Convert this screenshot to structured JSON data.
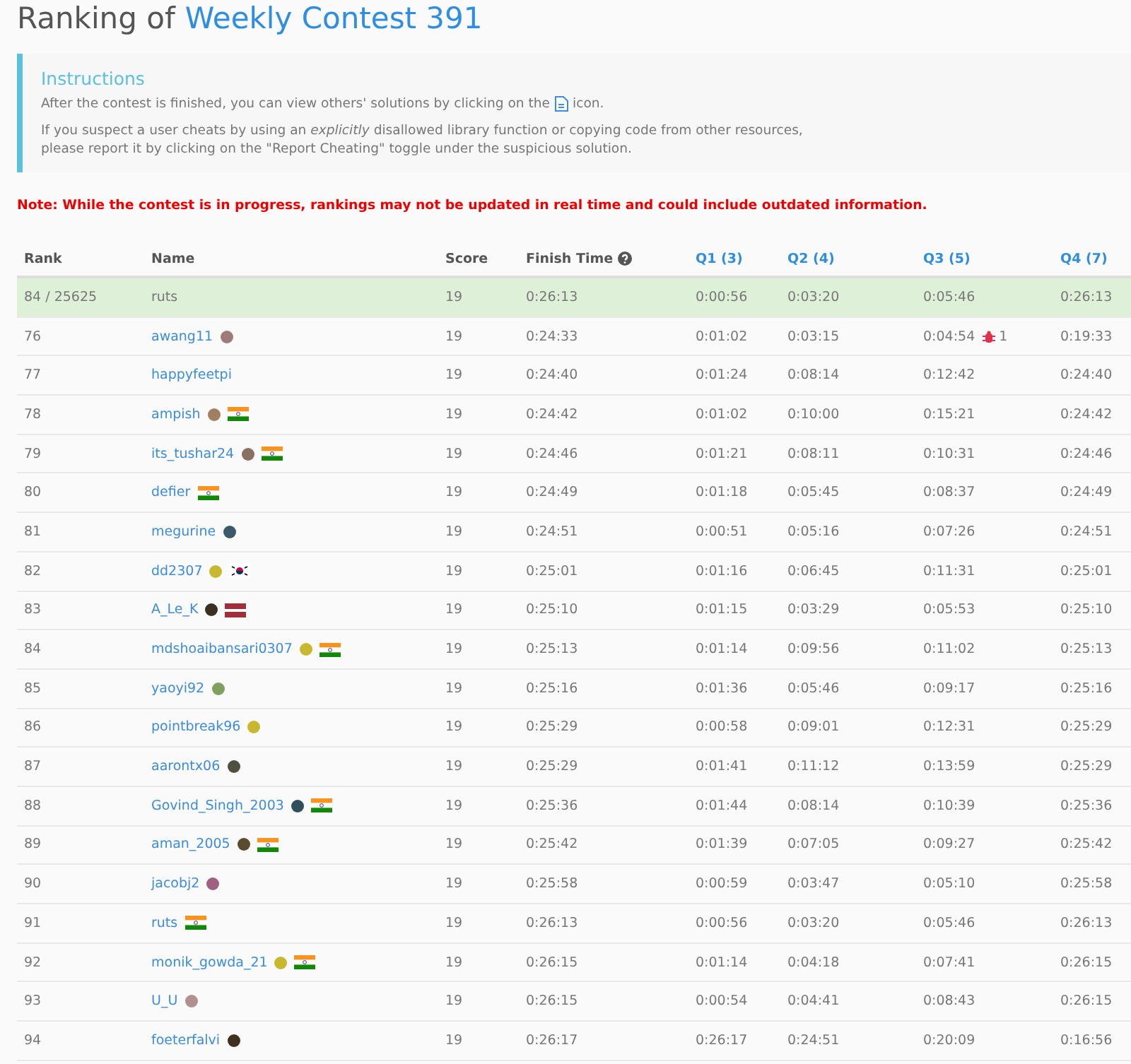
{
  "title": {
    "prefix": "Ranking of",
    "contest": "Weekly Contest 391"
  },
  "instructions": {
    "heading": "Instructions",
    "line1_before": "After the contest is finished, you can view others' solutions by clicking on the",
    "line1_after": "icon.",
    "paragraph2": "If you suspect a user cheats by using an *explicitly* disallowed library function or copying code from other resources, please report it by clicking on the \"Report Cheating\" toggle under the suspicious solution."
  },
  "note": "Note: While the contest is in progress, rankings may not be updated in real time and could include outdated information.",
  "table": {
    "columns": [
      "Rank",
      "Name",
      "Score",
      "Finish Time",
      "Q1 (3)",
      "Q2 (4)",
      "Q3 (5)",
      "Q4 (7)"
    ],
    "rows": [
      {
        "rank": "84 / 25625",
        "name": "ruts",
        "current": true,
        "score": "19",
        "finish": "0:26:13",
        "q": [
          "0:00:56",
          "0:03:20",
          "0:05:46",
          "0:26:13"
        ]
      },
      {
        "rank": "76",
        "name": "awang11",
        "current": false,
        "avatar": {
          "color": "#a07a7a"
        },
        "score": "19",
        "finish": "0:24:33",
        "q": [
          "0:01:02",
          "0:03:15",
          {
            "time": "0:04:54",
            "wrong": "1"
          },
          "0:19:33"
        ]
      },
      {
        "rank": "77",
        "name": "happyfeetpi",
        "current": false,
        "score": "19",
        "finish": "0:24:40",
        "q": [
          "0:01:24",
          "0:08:14",
          "0:12:42",
          "0:24:40"
        ]
      },
      {
        "rank": "78",
        "name": "ampish",
        "current": false,
        "avatar": {
          "color": "#a08060"
        },
        "flag": {
          "kind": "in"
        },
        "score": "19",
        "finish": "0:24:42",
        "q": [
          "0:01:02",
          "0:10:00",
          "0:15:21",
          "0:24:42"
        ]
      },
      {
        "rank": "79",
        "name": "its_tushar24",
        "current": false,
        "avatar": {
          "color": "#8a7060"
        },
        "flag": {
          "kind": "in"
        },
        "score": "19",
        "finish": "0:24:46",
        "q": [
          "0:01:21",
          "0:08:11",
          "0:10:31",
          "0:24:46"
        ]
      },
      {
        "rank": "80",
        "name": "defier",
        "current": false,
        "flag": {
          "kind": "in"
        },
        "score": "19",
        "finish": "0:24:49",
        "q": [
          "0:01:18",
          "0:05:45",
          "0:08:37",
          "0:24:49"
        ]
      },
      {
        "rank": "81",
        "name": "megurine",
        "current": false,
        "avatar": {
          "color": "#3a5a6a"
        },
        "score": "19",
        "finish": "0:24:51",
        "q": [
          "0:00:51",
          "0:05:16",
          "0:07:26",
          "0:24:51"
        ]
      },
      {
        "rank": "82",
        "name": "dd2307",
        "current": false,
        "avatar": {
          "color": "#c8b830"
        },
        "flag": {
          "kind": "kr"
        },
        "score": "19",
        "finish": "0:25:01",
        "q": [
          "0:01:16",
          "0:06:45",
          "0:11:31",
          "0:25:01"
        ]
      },
      {
        "rank": "83",
        "name": "A_Le_K",
        "current": false,
        "avatar": {
          "color": "#3a3020"
        },
        "flag": {
          "kind": "lv"
        },
        "score": "19",
        "finish": "0:25:10",
        "q": [
          "0:01:15",
          "0:03:29",
          "0:05:53",
          "0:25:10"
        ]
      },
      {
        "rank": "84",
        "name": "mdshoaibansari0307",
        "current": false,
        "avatar": {
          "color": "#c8b830"
        },
        "flag": {
          "kind": "in"
        },
        "score": "19",
        "finish": "0:25:13",
        "q": [
          "0:01:14",
          "0:09:56",
          "0:11:02",
          "0:25:13"
        ]
      },
      {
        "rank": "85",
        "name": "yaoyi92",
        "current": false,
        "avatar": {
          "color": "#80a060"
        },
        "score": "19",
        "finish": "0:25:16",
        "q": [
          "0:01:36",
          "0:05:46",
          "0:09:17",
          "0:25:16"
        ]
      },
      {
        "rank": "86",
        "name": "pointbreak96",
        "current": false,
        "avatar": {
          "color": "#c8b830"
        },
        "score": "19",
        "finish": "0:25:29",
        "q": [
          "0:00:58",
          "0:09:01",
          "0:12:31",
          "0:25:29"
        ]
      },
      {
        "rank": "87",
        "name": "aarontx06",
        "current": false,
        "avatar": {
          "color": "#505040"
        },
        "score": "19",
        "finish": "0:25:29",
        "q": [
          "0:01:41",
          "0:11:12",
          "0:13:59",
          "0:25:29"
        ]
      },
      {
        "rank": "88",
        "name": "Govind_Singh_2003",
        "current": false,
        "avatar": {
          "color": "#2f4f5a"
        },
        "flag": {
          "kind": "in"
        },
        "score": "19",
        "finish": "0:25:36",
        "q": [
          "0:01:44",
          "0:08:14",
          "0:10:39",
          "0:25:36"
        ]
      },
      {
        "rank": "89",
        "name": "aman_2005",
        "current": false,
        "avatar": {
          "color": "#5a4a30"
        },
        "flag": {
          "kind": "in"
        },
        "score": "19",
        "finish": "0:25:42",
        "q": [
          "0:01:39",
          "0:07:05",
          "0:09:27",
          "0:25:42"
        ]
      },
      {
        "rank": "90",
        "name": "jacobj2",
        "current": false,
        "avatar": {
          "color": "#a06080"
        },
        "score": "19",
        "finish": "0:25:58",
        "q": [
          "0:00:59",
          "0:03:47",
          "0:05:10",
          "0:25:58"
        ]
      },
      {
        "rank": "91",
        "name": "ruts",
        "current": false,
        "flag": {
          "kind": "in"
        },
        "score": "19",
        "finish": "0:26:13",
        "q": [
          "0:00:56",
          "0:03:20",
          "0:05:46",
          "0:26:13"
        ]
      },
      {
        "rank": "92",
        "name": "monik_gowda_21",
        "current": false,
        "avatar": {
          "color": "#c8b830"
        },
        "flag": {
          "kind": "in"
        },
        "score": "19",
        "finish": "0:26:15",
        "q": [
          "0:01:14",
          "0:04:18",
          "0:07:41",
          "0:26:15"
        ]
      },
      {
        "rank": "93",
        "name": "U_U",
        "current": false,
        "avatar": {
          "color": "#b09090"
        },
        "score": "19",
        "finish": "0:26:15",
        "q": [
          "0:00:54",
          "0:04:41",
          "0:08:43",
          "0:26:15"
        ]
      },
      {
        "rank": "94",
        "name": "foeterfalvi",
        "current": false,
        "avatar": {
          "color": "#403020"
        },
        "score": "19",
        "finish": "0:26:17",
        "q": [
          "0:26:17",
          "0:24:51",
          "0:20:09",
          "0:16:56"
        ]
      }
    ]
  }
}
